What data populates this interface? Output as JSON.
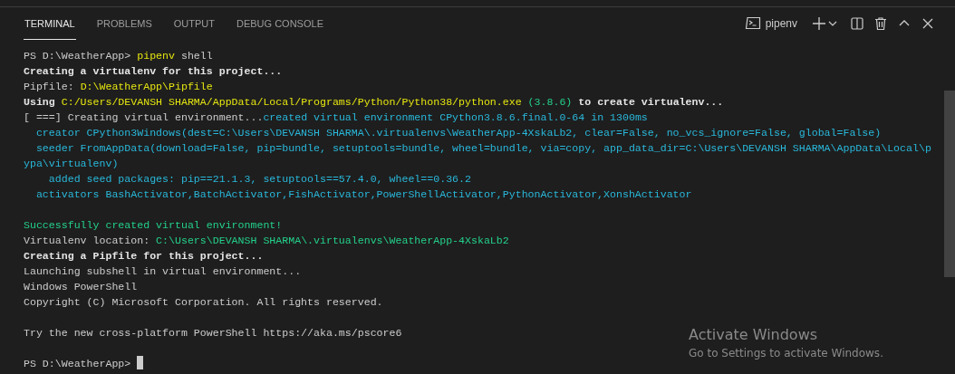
{
  "tabs": [
    {
      "label": "TERMINAL",
      "selected": true
    },
    {
      "label": "PROBLEMS",
      "selected": false
    },
    {
      "label": "OUTPUT",
      "selected": false
    },
    {
      "label": "DEBUG CONSOLE",
      "selected": false
    }
  ],
  "terminal_selector": {
    "label": "pipenv"
  },
  "terminal_lines": [
    {
      "kind": "text",
      "segments": [
        {
          "kind": "plain",
          "text": "PS D:\\WeatherApp> "
        },
        {
          "kind": "yellow",
          "text": "pipenv"
        },
        {
          "kind": "plain",
          "text": " shell"
        }
      ]
    },
    {
      "kind": "text",
      "segments": [
        {
          "kind": "bold",
          "text": "Creating a virtualenv for this project..."
        }
      ]
    },
    {
      "kind": "text",
      "segments": [
        {
          "kind": "plain",
          "text": "Pipfile: "
        },
        {
          "kind": "yellow",
          "text": "D:\\WeatherApp\\Pipfile"
        }
      ]
    },
    {
      "kind": "text",
      "segments": [
        {
          "kind": "bold",
          "text": "Using "
        },
        {
          "kind": "yellow",
          "text": "C:/Users/DEVANSH SHARMA/AppData/Local/Programs/Python/Python38/python.exe"
        },
        {
          "kind": "green",
          "text": " (3.8.6)"
        },
        {
          "kind": "bold",
          "text": " to create virtualenv..."
        }
      ]
    },
    {
      "kind": "text",
      "segments": [
        {
          "kind": "plain",
          "text": "[ ===] Creating virtual environment..."
        },
        {
          "kind": "cyan",
          "text": "created virtual environment CPython3.8.6.final.0-64 in 1300ms"
        }
      ]
    },
    {
      "kind": "text",
      "segments": [
        {
          "kind": "cyan",
          "text": "  creator CPython3Windows(dest=C:\\Users\\DEVANSH SHARMA\\.virtualenvs\\WeatherApp-4XskaLb2, clear=False, no_vcs_ignore=False, global=False)"
        }
      ]
    },
    {
      "kind": "text",
      "segments": [
        {
          "kind": "cyan",
          "text": "  seeder FromAppData(download=False, pip=bundle, setuptools=bundle, wheel=bundle, via=copy, app_data_dir=C:\\Users\\DEVANSH SHARMA\\AppData\\Local\\p"
        }
      ]
    },
    {
      "kind": "text",
      "segments": [
        {
          "kind": "cyan",
          "text": "ypa\\virtualenv)"
        }
      ]
    },
    {
      "kind": "text",
      "segments": [
        {
          "kind": "cyan",
          "text": "    added seed packages: pip==21.1.3, setuptools==57.4.0, wheel==0.36.2"
        }
      ]
    },
    {
      "kind": "text",
      "segments": [
        {
          "kind": "cyan",
          "text": "  activators BashActivator,BatchActivator,FishActivator,PowerShellActivator,PythonActivator,XonshActivator"
        }
      ]
    },
    {
      "kind": "blank"
    },
    {
      "kind": "text",
      "segments": [
        {
          "kind": "green",
          "text": "Successfully created virtual environment!"
        }
      ]
    },
    {
      "kind": "text",
      "segments": [
        {
          "kind": "plain",
          "text": "Virtualenv location: "
        },
        {
          "kind": "green",
          "text": "C:\\Users\\DEVANSH SHARMA\\.virtualenvs\\WeatherApp-4XskaLb2"
        }
      ]
    },
    {
      "kind": "text",
      "segments": [
        {
          "kind": "bold",
          "text": "Creating a Pipfile for this project..."
        }
      ]
    },
    {
      "kind": "text",
      "segments": [
        {
          "kind": "plain",
          "text": "Launching subshell in virtual environment..."
        }
      ]
    },
    {
      "kind": "text",
      "segments": [
        {
          "kind": "plain",
          "text": "Windows PowerShell"
        }
      ]
    },
    {
      "kind": "text",
      "segments": [
        {
          "kind": "plain",
          "text": "Copyright (C) Microsoft Corporation. All rights reserved."
        }
      ]
    },
    {
      "kind": "blank"
    },
    {
      "kind": "text",
      "segments": [
        {
          "kind": "plain",
          "text": "Try the new cross-platform PowerShell https://aka.ms/pscore6"
        }
      ]
    },
    {
      "kind": "blank"
    },
    {
      "kind": "prompt",
      "segments": [
        {
          "kind": "plain",
          "text": "PS D:\\WeatherApp>"
        }
      ]
    }
  ],
  "activation_notice": {
    "title": "Activate Windows",
    "message": "Go to Settings to activate Windows."
  }
}
